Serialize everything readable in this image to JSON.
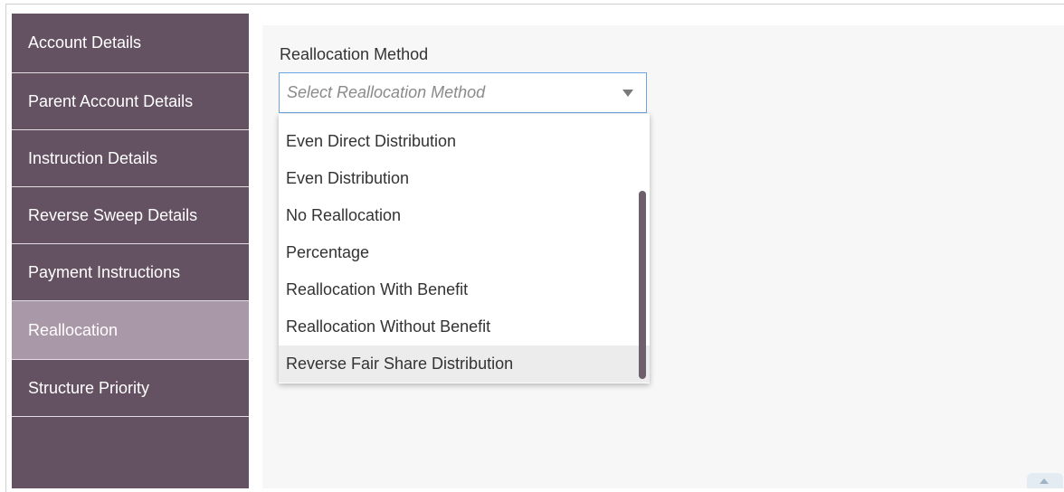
{
  "sidebar": {
    "items": [
      {
        "label": "Account Details"
      },
      {
        "label": "Parent Account Details"
      },
      {
        "label": "Instruction Details"
      },
      {
        "label": "Reverse Sweep Details"
      },
      {
        "label": "Payment Instructions"
      },
      {
        "label": "Reallocation",
        "active": true
      },
      {
        "label": "Structure Priority"
      }
    ]
  },
  "form": {
    "reallocation_label": "Reallocation Method",
    "select_placeholder": "Select Reallocation Method",
    "options": [
      "Even Direct Distribution",
      "Even Distribution",
      "No Reallocation",
      "Percentage",
      "Reallocation With Benefit",
      "Reallocation Without Benefit",
      "Reverse Fair Share Distribution"
    ],
    "highlighted_option": "Reverse Fair Share Distribution"
  },
  "colors": {
    "sidebar": "#645262",
    "sidebar_active": "#a998a7",
    "select_border": "#6aa7e0",
    "content_bg": "#f7f7f7"
  }
}
